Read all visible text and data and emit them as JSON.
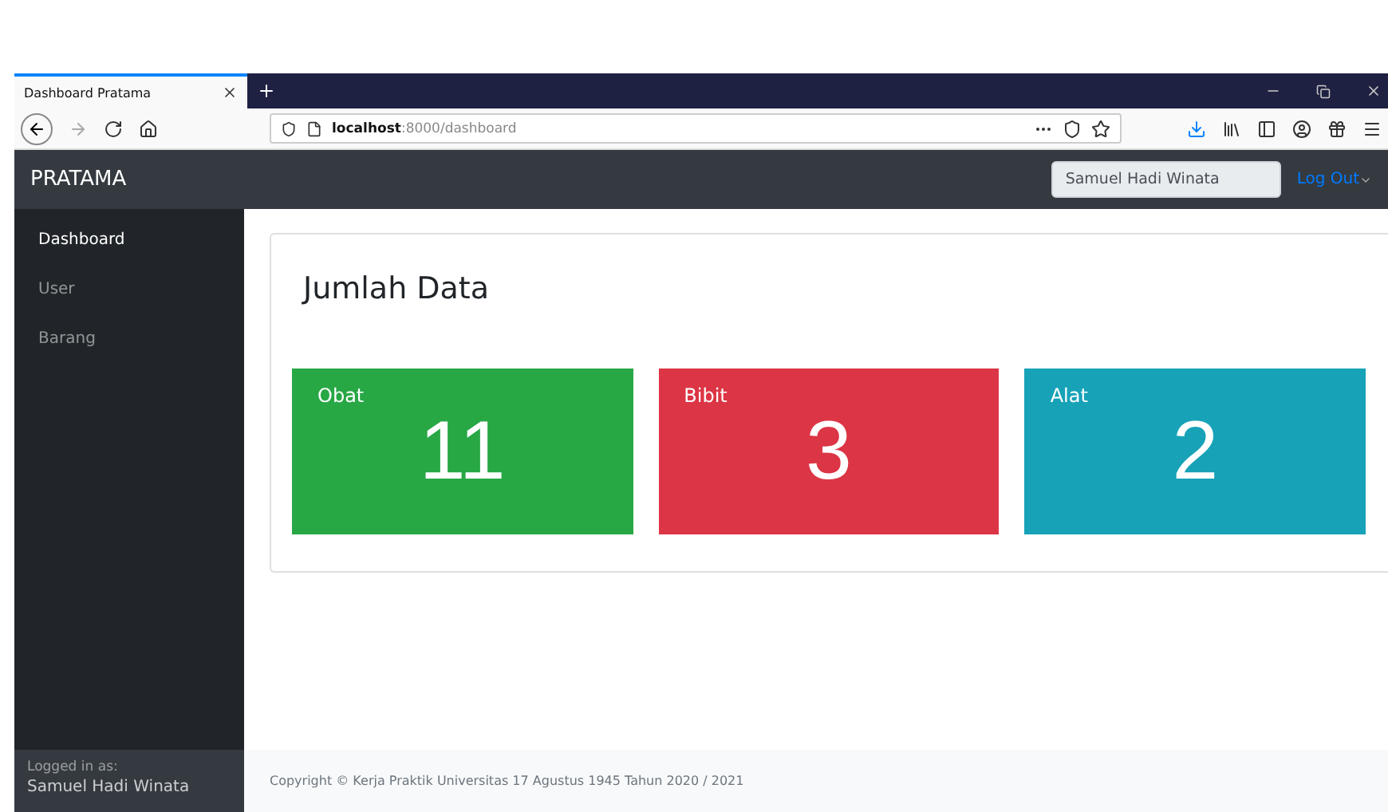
{
  "browser": {
    "tab_title": "Dashboard Pratama",
    "url_host": "localhost",
    "url_path": ":8000/dashboard"
  },
  "navbar": {
    "brand": "PRATAMA",
    "user_field": {
      "value": "Samuel Hadi Winata"
    },
    "logout": "Log Out"
  },
  "sidebar": {
    "items": [
      {
        "label": "Dashboard",
        "selected": true
      },
      {
        "label": "User",
        "selected": false
      },
      {
        "label": "Barang",
        "selected": false
      }
    ],
    "footer": {
      "label": "Logged in as:",
      "user": "Samuel Hadi Winata"
    }
  },
  "card": {
    "title": "Jumlah Data",
    "stats": [
      {
        "label": "Obat",
        "value": "11",
        "color": "#28a745"
      },
      {
        "label": "Bibit",
        "value": "3",
        "color": "#dc3545"
      },
      {
        "label": "Alat",
        "value": "2",
        "color": "#17a2b8"
      }
    ]
  },
  "footer": {
    "copyright": "Copyright © Kerja Praktik Universitas 17 Agustus 1945 Tahun 2020 / 2021"
  }
}
